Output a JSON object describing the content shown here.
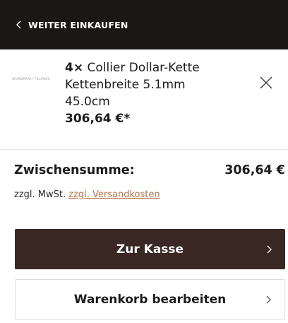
{
  "header": {
    "back_label": "WEITER EINKAUFEN"
  },
  "cart_item": {
    "thumbnail_text": "BRANDMARK / FILLIAKER",
    "quantity": "4×",
    "name": "Collier Dollar-Kette Kettenbreite 5.1mm 45.0cm",
    "price": "306,64 €*"
  },
  "summary": {
    "subtotal_label": "Zwischensumme:",
    "subtotal_value": "306,64 €",
    "tax_prefix": "zzgl. MwSt.",
    "shipping_link": "zzgl. Versandkosten"
  },
  "buttons": {
    "checkout": "Zur Kasse",
    "edit_cart": "Warenkorb bearbeiten"
  },
  "colors": {
    "header_bg": "#1a1716",
    "checkout_bg": "#3a2824",
    "link": "#b1704b"
  }
}
